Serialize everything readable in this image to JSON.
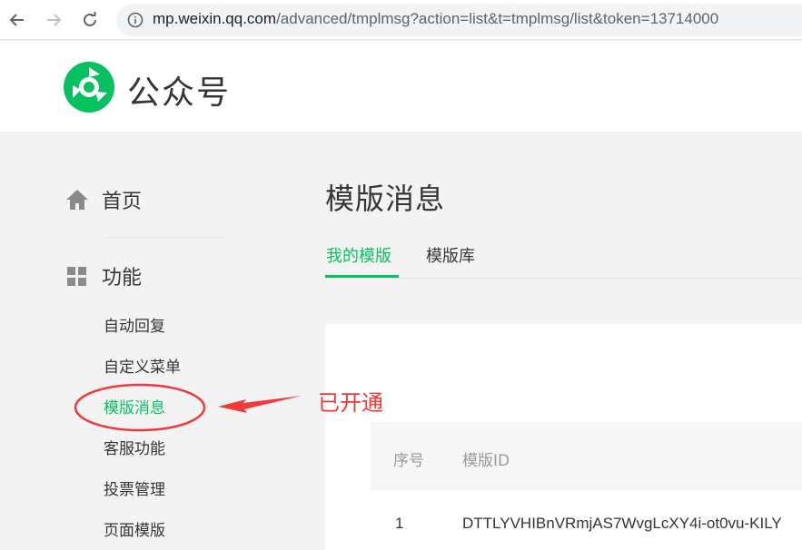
{
  "browser": {
    "url_host": "mp.weixin.qq.com",
    "url_path": "/advanced/tmplmsg?action=list&t=tmplmsg/list&token=13714000"
  },
  "header": {
    "brand": "公众号"
  },
  "sidebar": {
    "home_label": "首页",
    "features_label": "功能",
    "items": [
      {
        "label": "自动回复"
      },
      {
        "label": "自定义菜单"
      },
      {
        "label": "模版消息",
        "active": true
      },
      {
        "label": "客服功能"
      },
      {
        "label": "投票管理"
      },
      {
        "label": "页面模版"
      }
    ]
  },
  "main": {
    "title": "模版消息",
    "tabs": [
      {
        "label": "我的模版",
        "active": true
      },
      {
        "label": "模版库"
      }
    ],
    "table": {
      "columns": [
        "序号",
        "模版ID"
      ],
      "rows": [
        [
          "1",
          "DTTLYVHIBnVRmjAS7WvgLcXY4i-ot0vu-KILY"
        ]
      ]
    }
  },
  "annotation": {
    "text": "已开通"
  },
  "colors": {
    "accent": "#07c160",
    "annotation": "#f03a3a"
  }
}
